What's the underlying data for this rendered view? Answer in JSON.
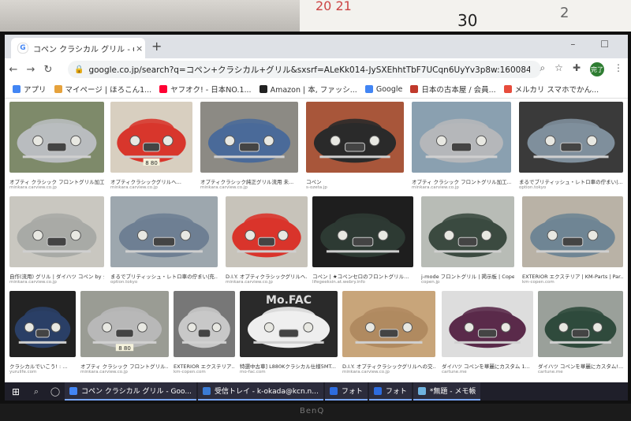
{
  "calendar": {
    "date_a": "20  21",
    "date_b": "30",
    "date_c": "2"
  },
  "browser": {
    "tab_title": "コペン クラシカル グリル - Google 検",
    "tab_close": "×",
    "new_tab": "+",
    "window_controls": "–  ☐",
    "url": "google.co.jp/search?q=コペン+クラシカル+グリル&sxsrf=ALeKk014-JySXEhhtTbF7UCqn6UyYv3p8w:1600843997194&source=ln...",
    "avatar": "完了"
  },
  "bookmarks": [
    {
      "label": "アプリ",
      "color": "#4285f4"
    },
    {
      "label": "マイページ | ほろこん1...",
      "color": "#e6a23c"
    },
    {
      "label": "ヤフオク! - 日本NO.1...",
      "color": "#ff0033"
    },
    {
      "label": "Amazon | 本, ファッシ...",
      "color": "#222222"
    },
    {
      "label": "Google",
      "color": "#4285f4"
    },
    {
      "label": "日本の古本屋 / 会員...",
      "color": "#c0392b"
    },
    {
      "label": "メルカリ スマホでかん...",
      "color": "#e74c3c"
    }
  ],
  "results": [
    {
      "caption": "オプティ クラシック フロントグリル加工...",
      "source": "minkara.carview.co.jp",
      "car": "#b9bcbf",
      "bg": "#7e8a6a"
    },
    {
      "caption": "オプティクラシックグリルへ...",
      "source": "minkara.carview.co.jp",
      "car": "#d8362c",
      "bg": "#d8cfc0"
    },
    {
      "caption": "オプティクラシック純正グリル流用 未...",
      "source": "minkara.carview.co.jp",
      "car": "#4a6a99",
      "bg": "#8c8a84"
    },
    {
      "caption": "コペン",
      "source": "s-ozeta.jp",
      "car": "#2a2a2a",
      "bg": "#a8563a"
    },
    {
      "caption": "オプティ クラシック フロントグリル加工...",
      "source": "minkara.carview.co.jp",
      "car": "#b5b7ba",
      "bg": "#8aa0b0"
    },
    {
      "caption": "まるでブリティッシュ・レトロ車の佇まい|...",
      "source": "option.tokyo",
      "car": "#7f8f9c",
      "bg": "#3a3a3a"
    },
    {
      "caption": "自作(流用) グリル | ダイハツ コペン by シ...",
      "source": "minkara.carview.co.jp",
      "car": "#a8aaa6",
      "bg": "#c9c7c0"
    },
    {
      "caption": "まるでブリティッシュ・レトロ車の佇まい|充...",
      "source": "option.tokyo",
      "car": "#6e7f93",
      "bg": "#9da7ae"
    },
    {
      "caption": "D.I.Y. オプティクラシックグリルへ...",
      "source": "minkara.carview.co.jp",
      "car": "#d9342b",
      "bg": "#c7c3ba"
    },
    {
      "caption": "コペン | ★コペンセロのフロントグリル...",
      "source": "lifegeeksin.at.webry.info",
      "car": "#2d3a33",
      "bg": "#1e1e1e"
    },
    {
      "caption": "j-mode フロントグリル | 掲示板 | Copen C...",
      "source": "copen.jp",
      "car": "#3b4a40",
      "bg": "#b8bcb6"
    },
    {
      "caption": "EXTERIOR エクステリア | KM-Parts | Par...",
      "source": "km-copen.com",
      "car": "#6f8594",
      "bg": "#b9b2a6"
    },
    {
      "caption": "クラシカルでいこう! : ...",
      "source": "yurulife.com",
      "car": "#2a3f66",
      "bg": "#222222"
    },
    {
      "caption": "オプティ クラシック フロントグリル...",
      "source": "minkara.carview.co.jp",
      "car": "#b8b8b8",
      "bg": "#9a9c94"
    },
    {
      "caption": "EXTERIOR エクステリア...",
      "source": "km-copen.com",
      "car": "#c8c8c8",
      "bg": "#777777"
    },
    {
      "caption": "特選中古車] L880Kクラシカル仕様5MT...",
      "source": "mo-fac.com",
      "car": "#eeeeee",
      "bg": "#2a2a2a"
    },
    {
      "caption": "D.I.Y. オプティクラシックグリルへの交...",
      "source": "minkara.carview.co.jp",
      "car": "#b08a60",
      "bg": "#c8a57a"
    },
    {
      "caption": "ダイハツ コペンを華麗にカスタム 1...",
      "source": "cartune.me",
      "car": "#5a2a4a",
      "bg": "#dddddd"
    },
    {
      "caption": "ダイハツ コペンを華麗にカスタム!...",
      "source": "cartune.me",
      "car": "#2f4a3c",
      "bg": "#9aa09a"
    }
  ],
  "photo_text": {
    "mofac": "Mo.FAC",
    "plate_a": "8 80",
    "plate_b": "8 80"
  },
  "taskbar": {
    "start": "⊞",
    "search": "⌕",
    "task": "◯",
    "items": [
      {
        "label": "コペン クラシカル グリル - Goo...",
        "color": "#4285f4"
      },
      {
        "label": "受信トレイ - k-okada@kcn.n...",
        "color": "#3a7bd5"
      },
      {
        "label": "フォト",
        "color": "#2d6cdf"
      },
      {
        "label": "フォト",
        "color": "#2d6cdf"
      },
      {
        "label": "*無題 - メモ帳",
        "color": "#6fb3e0"
      }
    ]
  },
  "monitor_brand": "BenQ"
}
